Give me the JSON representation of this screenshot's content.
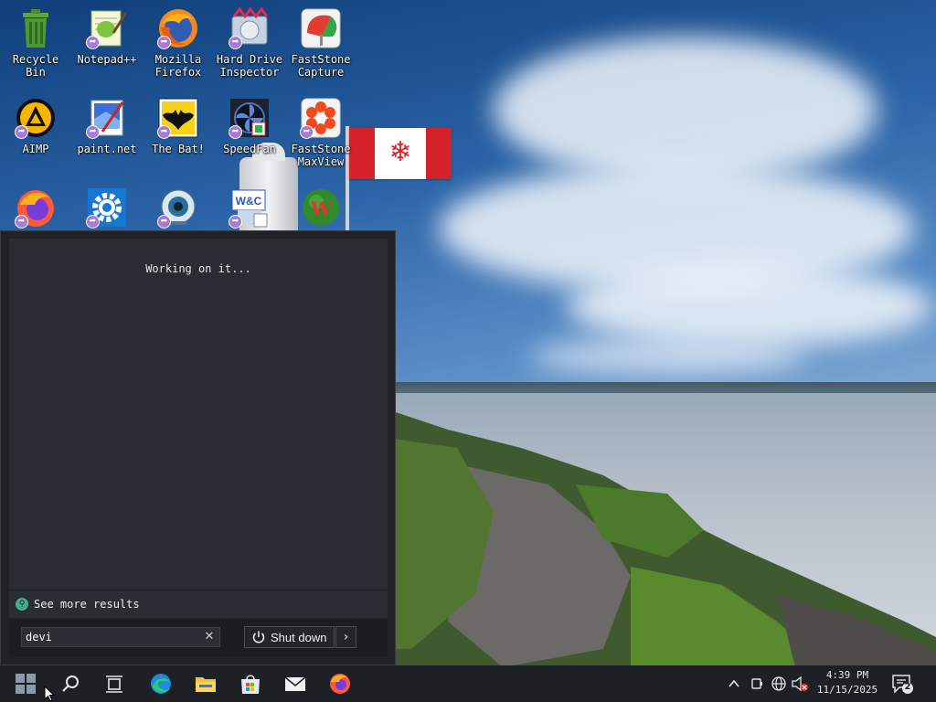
{
  "desktop": {
    "icons": [
      {
        "label": "Recycle\nBin",
        "icon": "recycle-bin-icon"
      },
      {
        "label": "Notepad++",
        "icon": "notepad-plus-plus-icon"
      },
      {
        "label": "Mozilla\nFirefox",
        "icon": "firefox-icon"
      },
      {
        "label": "Hard Drive\nInspector",
        "icon": "hard-drive-inspector-icon"
      },
      {
        "label": "FastStone\nCapture",
        "icon": "faststone-capture-icon"
      },
      {
        "label": "AIMP",
        "icon": "aimp-icon"
      },
      {
        "label": "paint.net",
        "icon": "paint-net-icon"
      },
      {
        "label": "The Bat!",
        "icon": "the-bat-icon"
      },
      {
        "label": "SpeedFan",
        "icon": "speedfan-icon"
      },
      {
        "label": "FastStone\nMaxView",
        "icon": "faststone-maxview-icon"
      },
      {
        "label": "",
        "icon": "firefox-alt-icon"
      },
      {
        "label": "",
        "icon": "settings-gear-icon"
      },
      {
        "label": "",
        "icon": "webcam-icon"
      },
      {
        "label": "",
        "icon": "wc-icon"
      },
      {
        "label": "",
        "icon": "w-ball-icon"
      }
    ]
  },
  "start_panel": {
    "status_text": "Working on it...",
    "see_more_label": "See more results",
    "search": {
      "value": "devi",
      "placeholder": ""
    },
    "shutdown_label": "Shut down"
  },
  "taskbar": {
    "apps": [
      "start-icon",
      "search-icon",
      "task-view-icon",
      "edge-icon",
      "file-explorer-icon",
      "microsoft-store-icon",
      "mail-icon",
      "firefox-icon"
    ],
    "clock_time": "4:39 PM",
    "clock_date": "11/15/2025",
    "notification_count": "2"
  },
  "colors": {
    "taskbar_bg": "#1d2025",
    "panel_bg": "#1f2227",
    "accent_search": "#3fb089",
    "flag_red": "#d5222a"
  }
}
